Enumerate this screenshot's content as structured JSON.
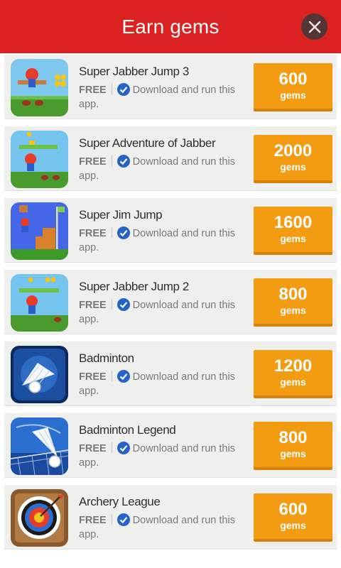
{
  "header": {
    "title": "Earn gems",
    "close_icon": "close-icon"
  },
  "offers": [
    {
      "name": "Super Jabber Jump 3",
      "price": "FREE",
      "description": "Download and run this app.",
      "gems": "600",
      "gems_unit": "gems",
      "icon": "mario-runner-icon"
    },
    {
      "name": "Super Adventure of Jabber",
      "price": "FREE",
      "description": "Download and run this app.",
      "gems": "2000",
      "gems_unit": "gems",
      "icon": "mario-jump-icon"
    },
    {
      "name": "Super Jim Jump",
      "price": "FREE",
      "description": "Download and run this app.",
      "gems": "1600",
      "gems_unit": "gems",
      "icon": "platformer-flag-icon"
    },
    {
      "name": "Super Jabber Jump 2",
      "price": "FREE",
      "description": "Download and run this app.",
      "gems": "800",
      "gems_unit": "gems",
      "icon": "mario-jump-icon"
    },
    {
      "name": "Badminton",
      "price": "FREE",
      "description": "Download and run this app.",
      "gems": "1200",
      "gems_unit": "gems",
      "icon": "shuttlecock-icon"
    },
    {
      "name": "Badminton Legend",
      "price": "FREE",
      "description": "Download and run this app.",
      "gems": "800",
      "gems_unit": "gems",
      "icon": "shuttlecock-net-icon"
    },
    {
      "name": "Archery League",
      "price": "FREE",
      "description": "Download and run this app.",
      "gems": "600",
      "gems_unit": "gems",
      "icon": "archery-target-icon"
    }
  ],
  "colors": {
    "header": "#dc2121",
    "card": "#efefed",
    "button": "#f39c12",
    "check": "#2563c9"
  }
}
